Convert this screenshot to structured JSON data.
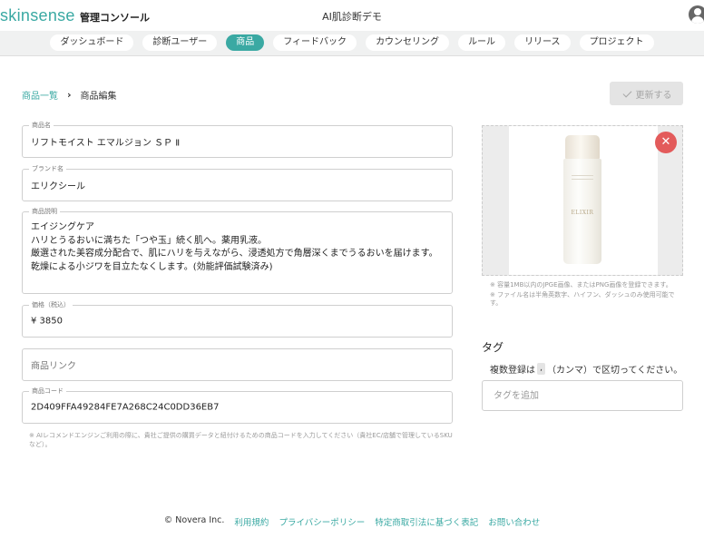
{
  "header": {
    "logo": "skinsense",
    "logo_sub": "管理コンソール",
    "app_title": "AI肌診断デモ",
    "account_icon": "account-circle-icon"
  },
  "nav": {
    "tabs": [
      {
        "label": "ダッシュボード",
        "active": false
      },
      {
        "label": "診断ユーザー",
        "active": false
      },
      {
        "label": "商品",
        "active": true
      },
      {
        "label": "フィードバック",
        "active": false
      },
      {
        "label": "カウンセリング",
        "active": false
      },
      {
        "label": "ルール",
        "active": false
      },
      {
        "label": "リリース",
        "active": false
      },
      {
        "label": "プロジェクト",
        "active": false
      }
    ]
  },
  "breadcrumb": {
    "parent": "商品一覧",
    "separator": "›",
    "current": "商品編集"
  },
  "update_button": {
    "label": "更新する",
    "icon": "check-icon",
    "enabled": false
  },
  "form": {
    "product_name": {
      "label": "商品名",
      "value": "リフトモイスト エマルジョン ＳＰ Ⅱ"
    },
    "brand_name": {
      "label": "ブランド名",
      "value": "エリクシール"
    },
    "description": {
      "label": "商品説明",
      "lines": [
        "エイジングケア",
        "ハリとうるおいに満ちた「つや玉」続く肌へ。薬用乳液。",
        "厳選された美容成分配合で、肌にハリを与えながら、浸透処方で角層深くまでうるおいを届けます。",
        "乾燥による小ジワを目立たなくします。(効能評価試験済み)"
      ]
    },
    "price": {
      "label": "価格（税込）",
      "value": "¥  3850"
    },
    "product_link": {
      "placeholder": "商品リンク",
      "value": ""
    },
    "product_code": {
      "label": "商品コード",
      "value": "2D409FFA49284FE7A268C24C0DD36EB7"
    },
    "product_code_hint": "※ AIレコメンドエンジンご利用の際に、貴社ご提供の購買データと紐付けるための商品コードを入力してください（貴社EC/店舗で管理しているSKUなど）。"
  },
  "image": {
    "bottle_brand": "ELIXIR",
    "remove_icon": "close-icon",
    "hints": [
      "※ 容量1MB以内のJPGE画像、またはPNG画像を登録できます。",
      "※ ファイル名は半角英数字、ハイフン、ダッシュのみ使用可能です。"
    ]
  },
  "tags": {
    "title": "タグ",
    "help_before": "複数登録は",
    "help_key": ",",
    "help_after": "（カンマ）で区切ってください。",
    "placeholder": "タグを追加"
  },
  "footer": {
    "copyright": "© Novera Inc.",
    "links": [
      "利用規約",
      "プライバシーポリシー",
      "特定商取引法に基づく表記",
      "お問い合わせ"
    ]
  },
  "colors": {
    "accent": "#3aa9a3",
    "danger": "#e35b5b",
    "nav_bg": "#f0f1f1"
  }
}
